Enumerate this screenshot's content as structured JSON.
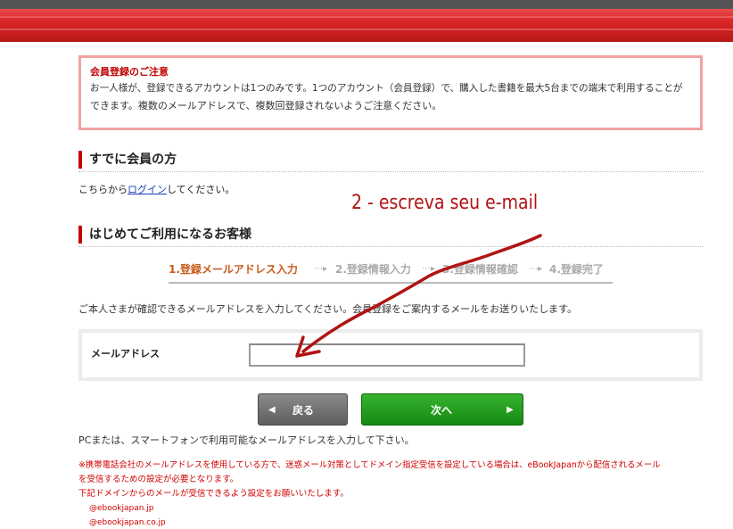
{
  "notice": {
    "title": "会員登録のご注意",
    "line1": "お一人様が、登録できるアカウントは1つのみです。1つのアカウント（会員登録）で、購入した書籍を最大5台までの端末で利用することが",
    "line2": "できます。複数のメールアドレスで、複数回登録されないようご注意ください。"
  },
  "existing_member": {
    "heading": "すでに会員の方",
    "text_before": "こちらから",
    "login_link": "ログイン",
    "text_after": "してください。"
  },
  "annotation": {
    "text": "2 - escreva seu e-mail",
    "color": "#b01414"
  },
  "new_member": {
    "heading": "はじめてご利用になるお客様"
  },
  "steps": {
    "step1": "1.登録メールアドレス入力",
    "step2": "2.登録情報入力",
    "step3": "3.登録情報確認",
    "step4": "4.登録完了",
    "arrow": "⋯▸"
  },
  "instruction": "ご本人さまが確認できるメールアドレスを入力してください。会員登録をご案内するメールをお送りいたします。",
  "form": {
    "email_label": "メールアドレス",
    "email_value": ""
  },
  "buttons": {
    "back": "戻る",
    "next": "次へ"
  },
  "pc_note": "PCまたは、スマートフォンで利用可能なメールアドレスを入力して下さい。",
  "warning": {
    "line1": "※携帯電話会社のメールアドレスを使用している方で、迷惑メール対策としてドメイン指定受信を設定している場合は、eBookJapanから配信されるメール",
    "line2": "を受信するための設定が必要となります。",
    "line3": "下記ドメインからのメールが受信できるよう設定をお願いいたします。",
    "domains": [
      "@ebookjapan.jp",
      "@ebookjapan.co.jp"
    ]
  },
  "colors": {
    "brand_red": "#d82424",
    "accent_orange": "#c85a1a",
    "next_green": "#1f9a1a",
    "warning_red": "#d00000"
  }
}
